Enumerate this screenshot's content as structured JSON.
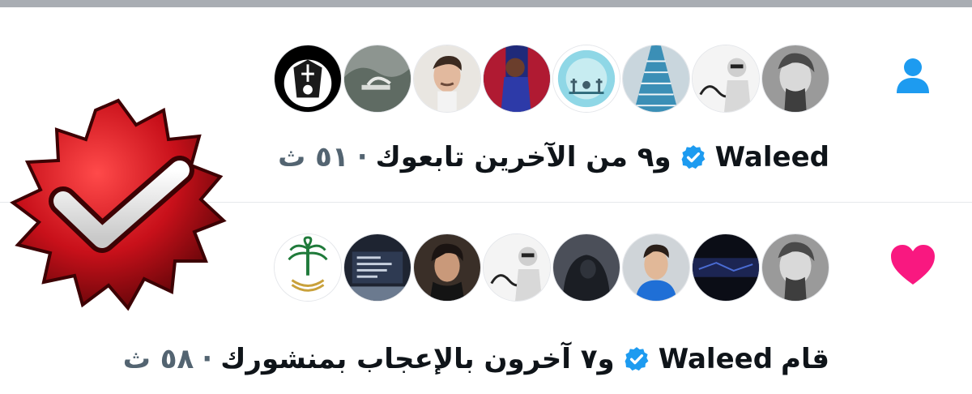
{
  "notifications": [
    {
      "type": "follow",
      "icon": "person-icon",
      "avatars": [
        "old-man-bw",
        "calligraphy-portrait",
        "blue-staircase",
        "tree-circle-logo",
        "football-player",
        "young-man",
        "misty-hills",
        "club-crest"
      ],
      "name": "Waleed",
      "rest": "و٩ من الآخرين تابعوك",
      "time": "٥١ ث",
      "separator": "·"
    },
    {
      "type": "like",
      "icon": "heart-icon",
      "avatars": [
        "old-man-bw",
        "night-scene",
        "boy-blue-hoodie",
        "hooded-figure",
        "calligraphy-portrait",
        "young-man-dark",
        "poster",
        "saudi-emblem"
      ],
      "prefix": "قام",
      "name": "Waleed",
      "rest": "و٧ آخرون بالإعجاب بمنشورك",
      "time": "٥٨ ث",
      "separator": "·"
    }
  ],
  "colors": {
    "accent_blue": "#1d9bf0",
    "like_pink": "#f91880",
    "text": "#0f1419",
    "muted": "#536471",
    "badge_red": "#c8101a"
  }
}
